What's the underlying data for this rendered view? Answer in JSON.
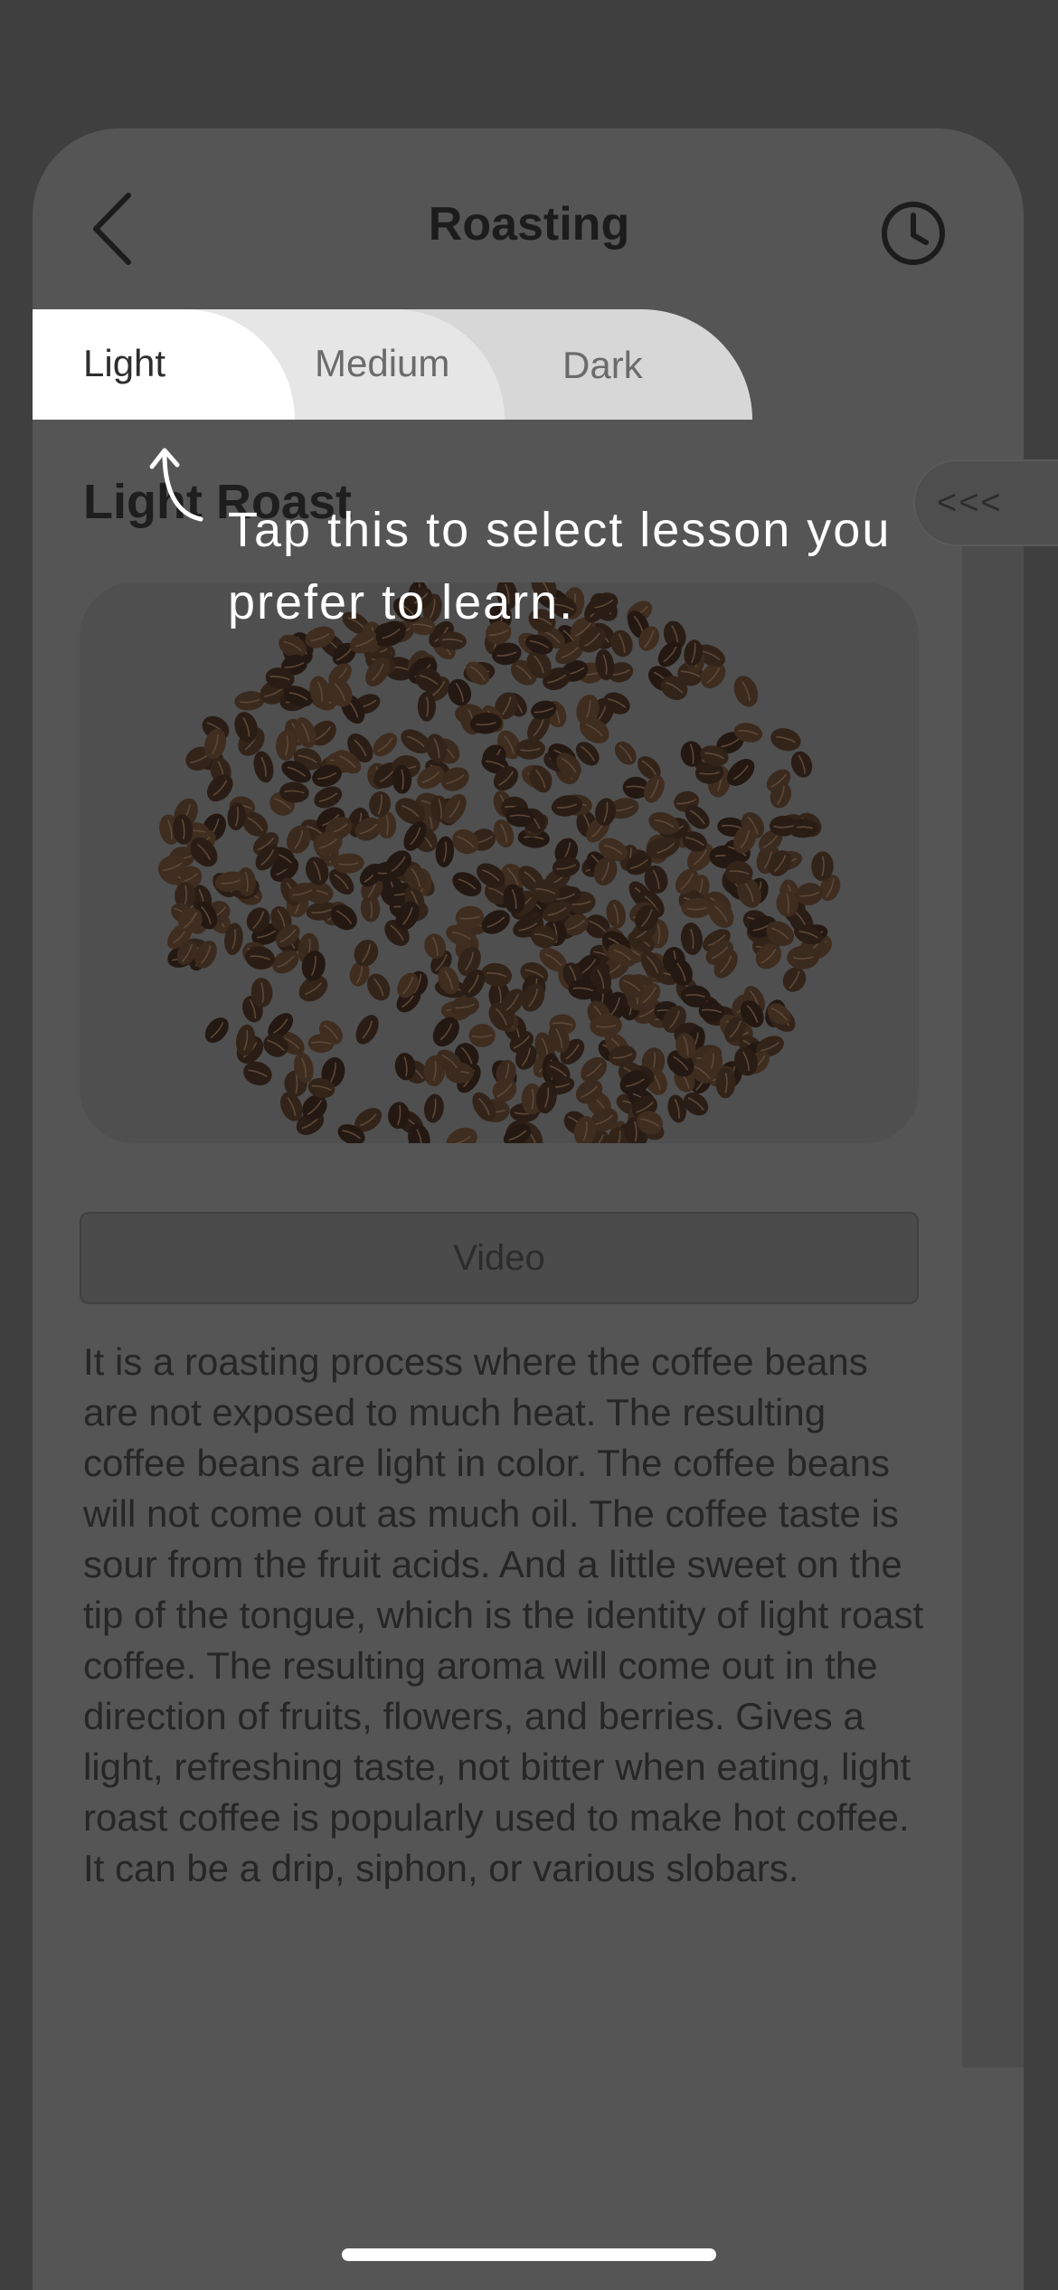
{
  "header": {
    "title": "Roasting",
    "back_icon": "chevron-left-icon",
    "history_icon": "clock-icon"
  },
  "tabs": [
    {
      "label": "Light",
      "selected": true
    },
    {
      "label": "Medium",
      "selected": false
    },
    {
      "label": "Dark",
      "selected": false
    }
  ],
  "lesson": {
    "title": "Light Roast",
    "image_icon": "coffee-beans-image",
    "video_label": "Video",
    "description": "It is a roasting process where the coffee beans are not exposed to much heat. The resulting coffee beans are light in color. The coffee beans will not come out as much oil. The coffee taste is sour from the fruit acids. And a little sweet on the tip of the tongue, which is the identity of light roast coffee. The resulting aroma will come out in the direction of fruits, flowers, and berries. Gives a light, refreshing taste, not bitter when eating, light roast coffee is popularly used to make hot coffee. It can be a drip, siphon, or various slobars."
  },
  "side_panel": {
    "toggle_label": "<<<"
  },
  "coach_mark": {
    "text": "Tap this to select lesson you prefer to learn.",
    "arrow_icon": "curved-arrow-up-icon"
  },
  "colors": {
    "overlay_background": "#3f3f3f",
    "card_background": "#555555",
    "tab_selected": "#ffffff",
    "tab_medium": "#e6e6e6",
    "tab_dark": "#d7d7d7",
    "coach_text": "#ffffff"
  }
}
